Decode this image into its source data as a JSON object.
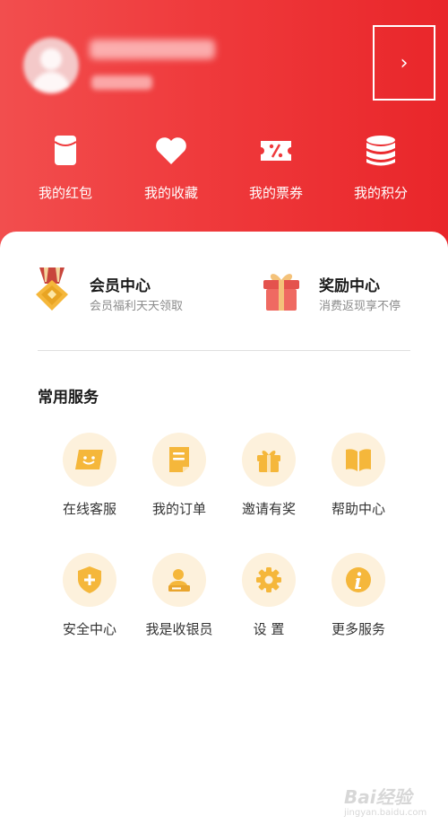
{
  "header": {
    "arrow_glyph": "›"
  },
  "quick_actions": [
    {
      "label": "我的红包",
      "icon": "red-envelope-icon"
    },
    {
      "label": "我的收藏",
      "icon": "heart-icon"
    },
    {
      "label": "我的票券",
      "icon": "coupon-icon"
    },
    {
      "label": "我的积分",
      "icon": "coins-icon"
    }
  ],
  "promos": [
    {
      "title": "会员中心",
      "subtitle": "会员福利天天领取",
      "icon": "medal-icon"
    },
    {
      "title": "奖励中心",
      "subtitle": "消费返现享不停",
      "icon": "gift-box-icon"
    }
  ],
  "services": {
    "title": "常用服务",
    "items": [
      {
        "label": "在线客服",
        "icon": "chat-icon"
      },
      {
        "label": "我的订单",
        "icon": "order-icon"
      },
      {
        "label": "邀请有奖",
        "icon": "gift-icon"
      },
      {
        "label": "帮助中心",
        "icon": "book-icon"
      },
      {
        "label": "安全中心",
        "icon": "shield-icon"
      },
      {
        "label": "我是收银员",
        "icon": "cashier-icon"
      },
      {
        "label": "设 置",
        "icon": "gear-icon"
      },
      {
        "label": "更多服务",
        "icon": "info-icon"
      }
    ]
  },
  "watermark": {
    "main": "Bai经验",
    "sub": "jingyan.baidu.com"
  },
  "colors": {
    "header_red": "#ef3a3c",
    "service_icon": "#f5b73b",
    "service_bg": "#fdf1dc"
  }
}
